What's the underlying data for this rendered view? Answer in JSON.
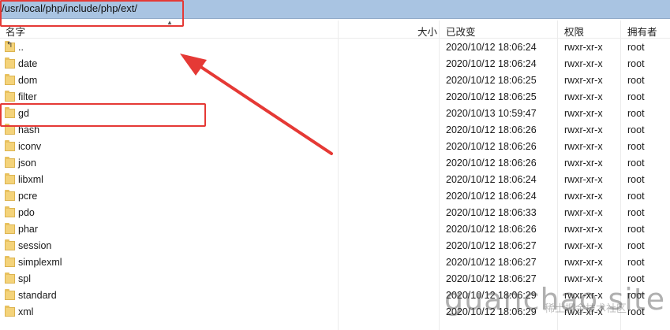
{
  "path": "/usr/local/php/include/php/ext/",
  "columns": {
    "name": "名字",
    "size": "大小",
    "modified": "已改变",
    "permissions": "权限",
    "owner": "拥有者"
  },
  "rows": [
    {
      "name": "..",
      "modified": "2020/10/12 18:06:24",
      "permissions": "rwxr-xr-x",
      "owner": "root",
      "icon": "parent-folder-icon"
    },
    {
      "name": "date",
      "modified": "2020/10/12 18:06:24",
      "permissions": "rwxr-xr-x",
      "owner": "root",
      "icon": "folder-icon"
    },
    {
      "name": "dom",
      "modified": "2020/10/12 18:06:25",
      "permissions": "rwxr-xr-x",
      "owner": "root",
      "icon": "folder-icon"
    },
    {
      "name": "filter",
      "modified": "2020/10/12 18:06:25",
      "permissions": "rwxr-xr-x",
      "owner": "root",
      "icon": "folder-icon"
    },
    {
      "name": "gd",
      "modified": "2020/10/13 10:59:47",
      "permissions": "rwxr-xr-x",
      "owner": "root",
      "icon": "folder-icon"
    },
    {
      "name": "hash",
      "modified": "2020/10/12 18:06:26",
      "permissions": "rwxr-xr-x",
      "owner": "root",
      "icon": "folder-icon"
    },
    {
      "name": "iconv",
      "modified": "2020/10/12 18:06:26",
      "permissions": "rwxr-xr-x",
      "owner": "root",
      "icon": "folder-icon"
    },
    {
      "name": "json",
      "modified": "2020/10/12 18:06:26",
      "permissions": "rwxr-xr-x",
      "owner": "root",
      "icon": "folder-icon"
    },
    {
      "name": "libxml",
      "modified": "2020/10/12 18:06:24",
      "permissions": "rwxr-xr-x",
      "owner": "root",
      "icon": "folder-icon"
    },
    {
      "name": "pcre",
      "modified": "2020/10/12 18:06:24",
      "permissions": "rwxr-xr-x",
      "owner": "root",
      "icon": "folder-icon"
    },
    {
      "name": "pdo",
      "modified": "2020/10/12 18:06:33",
      "permissions": "rwxr-xr-x",
      "owner": "root",
      "icon": "folder-icon"
    },
    {
      "name": "phar",
      "modified": "2020/10/12 18:06:26",
      "permissions": "rwxr-xr-x",
      "owner": "root",
      "icon": "folder-icon"
    },
    {
      "name": "session",
      "modified": "2020/10/12 18:06:27",
      "permissions": "rwxr-xr-x",
      "owner": "root",
      "icon": "folder-icon"
    },
    {
      "name": "simplexml",
      "modified": "2020/10/12 18:06:27",
      "permissions": "rwxr-xr-x",
      "owner": "root",
      "icon": "folder-icon"
    },
    {
      "name": "spl",
      "modified": "2020/10/12 18:06:27",
      "permissions": "rwxr-xr-x",
      "owner": "root",
      "icon": "folder-icon"
    },
    {
      "name": "standard",
      "modified": "2020/10/12 18:06:29",
      "permissions": "rwxr-xr-x",
      "owner": "root",
      "icon": "folder-icon"
    },
    {
      "name": "xml",
      "modified": "2020/10/12 18:06:29",
      "permissions": "rwxr-xr-x",
      "owner": "root",
      "icon": "folder-icon"
    }
  ],
  "annotation": {
    "color": "#e53935"
  },
  "watermark": {
    "text": "guanchao.site",
    "subtext": "稀土掘金技术社区"
  },
  "colors": {
    "pathbar": "#a9c4e2",
    "folder": "#f4d37a"
  }
}
